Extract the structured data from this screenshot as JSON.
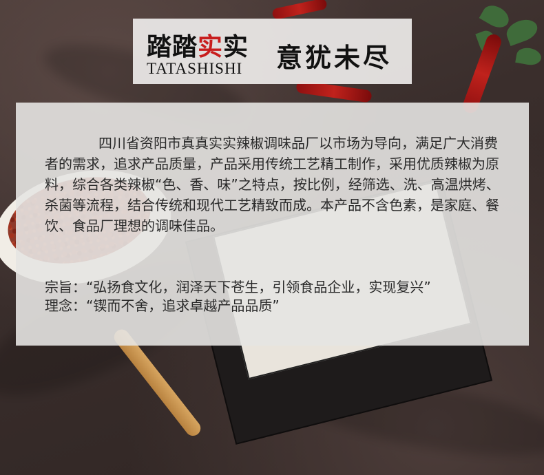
{
  "brand": {
    "name_cn_part1": "踏踏",
    "name_cn_part2": "实",
    "name_cn_part3": "实",
    "name_en": "TATASHISHI",
    "slogan": "意犹未尽"
  },
  "description": "四川省资阳市真真实实辣椒调味品厂以市场为导向，满足广大消费者的需求，追求产品质量，产品采用传统工艺精工制作，采用优质辣椒为原料，综合各类辣椒“色、香、味”之特点，按比例，经筛选、洗、高温烘烤、杀菌等流程，结合传统和现代工艺精致而成。本产品不含色素，是家庭、餐饮、食品厂理想的调味佳品。",
  "principles": {
    "tenet": "宗旨：“弘扬食文化，润泽天下苍生，引领食品企业，实现复兴”",
    "philosophy": "理念：“锲而不舍，追求卓越产品品质”"
  },
  "colors": {
    "brand_red": "#c81d1d",
    "text": "#2a2a2a",
    "fabric": "#3b2f2d"
  }
}
